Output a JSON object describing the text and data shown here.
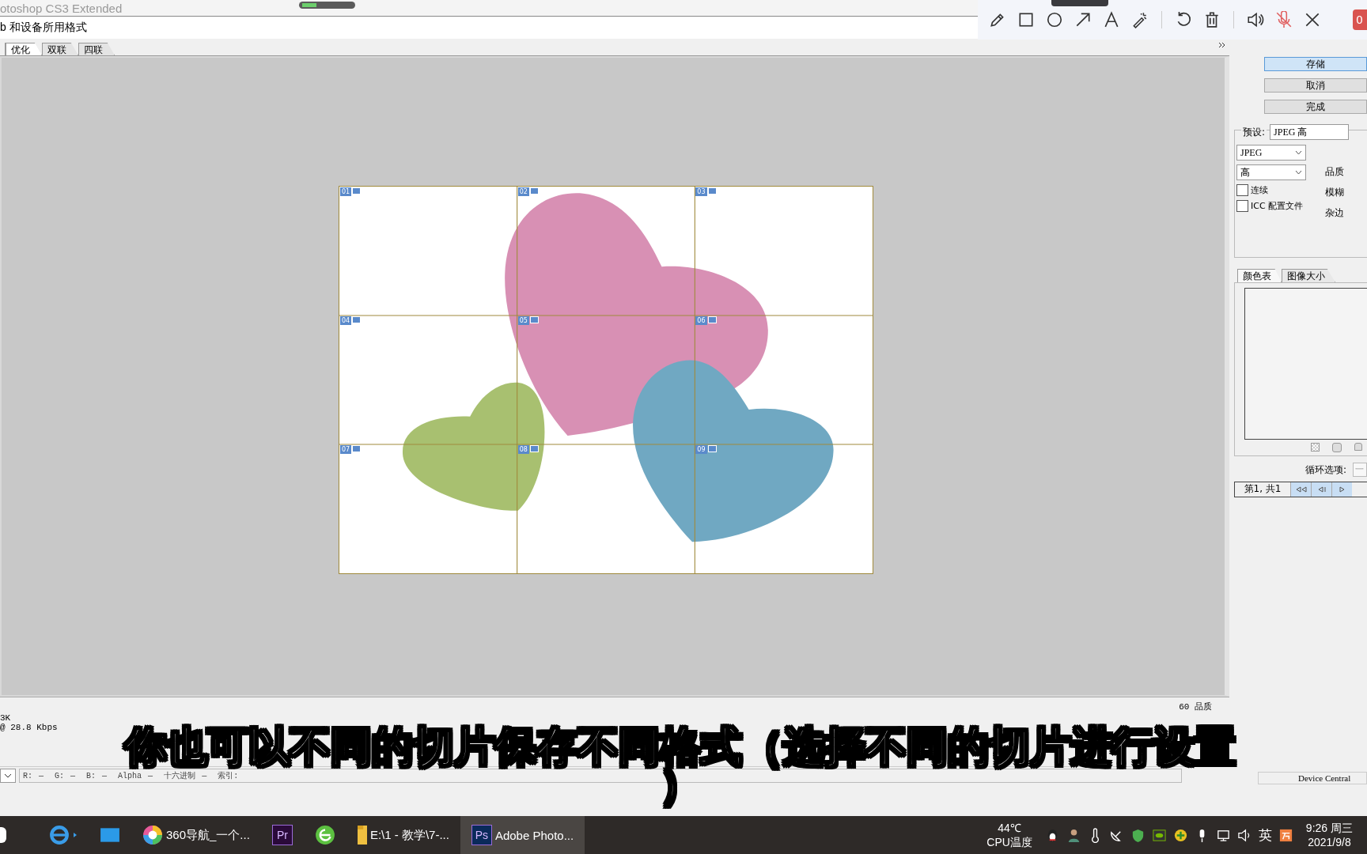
{
  "app_title": "otoshop CS3 Extended",
  "dialog_title": "b 和设备所用格式",
  "view_tabs": [
    {
      "label": "优化",
      "selected": true
    },
    {
      "label": "双联",
      "selected": false
    },
    {
      "label": "四联",
      "selected": false
    }
  ],
  "slices": [
    {
      "label": "01"
    },
    {
      "label": "02"
    },
    {
      "label": "03"
    },
    {
      "label": "04"
    },
    {
      "label": "05"
    },
    {
      "label": "06"
    },
    {
      "label": "07"
    },
    {
      "label": "08"
    },
    {
      "label": "09"
    }
  ],
  "right_panel": {
    "buttons": [
      {
        "label": "存储",
        "selected": true
      },
      {
        "label": "取消",
        "selected": false
      },
      {
        "label": "完成",
        "selected": false
      }
    ],
    "preset_label": "预设:",
    "preset_value": "JPEG 高",
    "format": "JPEG",
    "quality_setting": "高",
    "checkboxes": [
      {
        "label": "连续",
        "checked": false
      },
      {
        "label": "ICC 配置文件",
        "checked": false
      }
    ],
    "side_labels": [
      "品质",
      "模糊",
      "杂边"
    ],
    "panel_tabs": [
      {
        "label": "颜色表",
        "selected": true
      },
      {
        "label": "图像大小",
        "selected": false
      }
    ],
    "loop_label": "循环选项:",
    "loop_value": "一",
    "frame_counter": "第1, 共1"
  },
  "status": {
    "size": "3K",
    "speed": "@ 28.8 Kbps",
    "quality": "60 品质"
  },
  "color_readout": [
    {
      "label": "R:",
      "value": "—"
    },
    {
      "label": "G:",
      "value": "—"
    },
    {
      "label": "B:",
      "value": "—"
    },
    {
      "label": "Alpha",
      "value": "—"
    },
    {
      "label": "十六进制",
      "value": "—"
    }
  ],
  "index_label": "索引:",
  "device_central": "Device Central",
  "recorder": {
    "timer": "0"
  },
  "subtitle": [
    "你也可以不同的切片保存不同格式（选择不同的切片进行设置",
    "）"
  ],
  "taskbar": {
    "items": [
      {
        "kind": "browser-e",
        "selected": false
      },
      {
        "kind": "mail",
        "selected": false
      },
      {
        "kind": "color-ball",
        "label": "360导航_一个...",
        "selected": false
      },
      {
        "kind": "badge-app",
        "badge": "Pr",
        "color": "#2a0a3a",
        "selected": false
      },
      {
        "kind": "green-e",
        "selected": false
      },
      {
        "kind": "folder",
        "label": "E:\\1 - 教学\\7-...",
        "selected": false
      },
      {
        "kind": "badge-app",
        "badge": "Ps",
        "color": "#0a2a5a",
        "label": "Adobe Photo...",
        "selected": true
      }
    ],
    "temperature": "44℃",
    "temperature_label": "CPU温度",
    "ime": "英",
    "time": "9:26 周三",
    "date": "2021/9/8"
  }
}
